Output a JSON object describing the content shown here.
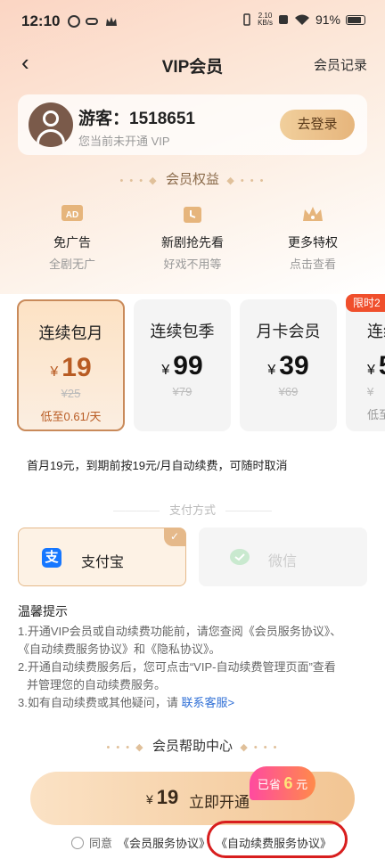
{
  "status_bar": {
    "time": "12:10",
    "net_speed": "2.10\nKB/s",
    "battery": "91%"
  },
  "nav": {
    "title": "VIP会员",
    "records": "会员记录"
  },
  "user": {
    "name": "游客：1518651",
    "status": "您当前未开通 VIP",
    "login_label": "去登录"
  },
  "benefits": {
    "title": "会员权益",
    "items": [
      {
        "icon": "ad-icon",
        "title": "免广告",
        "sub": "全剧无广"
      },
      {
        "icon": "clock-icon",
        "title": "新剧抢先看",
        "sub": "好戏不用等"
      },
      {
        "icon": "crown-icon",
        "title": "更多特权",
        "sub": "点击查看"
      }
    ]
  },
  "plans": [
    {
      "name": "连续包月",
      "yen": "¥",
      "price": "19",
      "original": "¥25",
      "daily": "低至0.61/天",
      "selected": true
    },
    {
      "name": "连续包季",
      "yen": "¥",
      "price": "99",
      "original": "¥79",
      "daily": "",
      "selected": false
    },
    {
      "name": "月卡会员",
      "yen": "¥",
      "price": "39",
      "original": "¥69",
      "daily": "",
      "selected": false
    },
    {
      "name": "连续",
      "yen": "¥",
      "price": "5",
      "original": "¥",
      "daily": "低至",
      "selected": false
    }
  ],
  "plan_tag": "限时2",
  "renew_note": "首月19元，到期前按19元/月自动续费，可随时取消",
  "payment": {
    "title": "支付方式",
    "options": [
      {
        "name": "支付宝",
        "icon": "alipay-icon",
        "selected": true
      },
      {
        "name": "微信",
        "icon": "wechat-icon",
        "selected": false
      }
    ]
  },
  "tips": {
    "title": "温馨提示",
    "line1a": "1.开通VIP会员或自动续费功能前，请您查阅《会员服务协议》、",
    "line1b": "《自动续费服务协议》和《隐私协议》。",
    "line2a": "2.开通自动续费服务后，您可点击“VIP-自动续费管理页面”查看",
    "line2b": "并管理您的自动续费服务。",
    "line3": "3.如有自动续费或其他疑问，请 ",
    "line3_link": "联系客服>"
  },
  "help_title": "会员帮助中心",
  "cta": {
    "yen": "¥",
    "price": "19",
    "label": "立即开通",
    "save_prefix": "已省",
    "save_amount": "6",
    "save_suffix": "元"
  },
  "agreement": {
    "prefix": "同意",
    "link1": "《会员服务协议》",
    "link2": "《自动续费服务协议》"
  },
  "colors": {
    "accent": "#b85b23",
    "gold": "#e6b57c",
    "link": "#2f6fd6",
    "highlight": "#d81e1e"
  }
}
